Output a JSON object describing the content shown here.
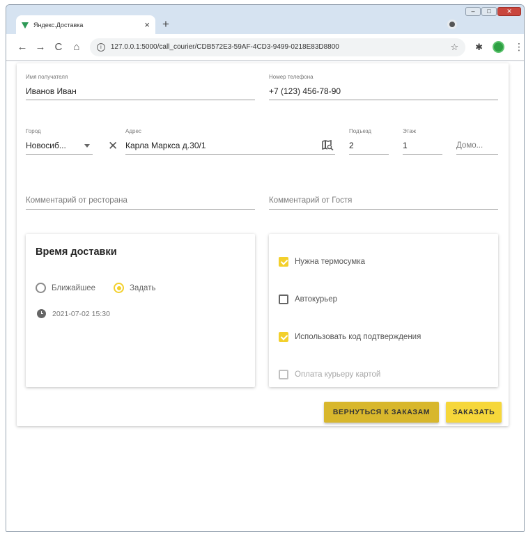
{
  "browser": {
    "tab_title": "Яндекс.Доставка",
    "tab_close": "×",
    "new_tab": "+",
    "url": "127.0.0.1:5000/call_courier/CDB572E3-59AF-4CD3-9499-0218E83D8800",
    "nav": {
      "back": "←",
      "forward": "→",
      "reload": "C",
      "home": "⌂"
    },
    "info_glyph": "i",
    "star_glyph": "☆",
    "extension_glyph": "✱",
    "menu_glyph": "⋮",
    "window_controls": {
      "minimize": "–",
      "maximize": "□",
      "close": "✕"
    }
  },
  "form": {
    "recipient": {
      "label": "Имя получателя",
      "value": "Иванов Иван"
    },
    "phone": {
      "label": "Номер телефона",
      "value": "+7 (123) 456-78-90"
    },
    "city": {
      "label": "Город",
      "value": "Новосиб..."
    },
    "address": {
      "label": "Адрес",
      "value": "Карла Маркса д.30/1",
      "clear_glyph": "✕"
    },
    "entrance": {
      "label": "Подъезд",
      "value": "2"
    },
    "floor": {
      "label": "Этаж",
      "value": "1"
    },
    "intercom": {
      "placeholder": "Домо..."
    },
    "restaurant_comment": {
      "placeholder": "Комментарий от ресторана"
    },
    "guest_comment": {
      "placeholder": "Комментарий от Гостя"
    }
  },
  "delivery": {
    "title": "Время доставки",
    "options": [
      {
        "label": "Ближайшее",
        "selected": false
      },
      {
        "label": "Задать",
        "selected": true
      }
    ],
    "datetime": "2021-07-02 15:30"
  },
  "options": [
    {
      "label": "Нужна термосумка",
      "checked": true,
      "disabled": false
    },
    {
      "label": "Автокурьер",
      "checked": false,
      "disabled": false
    },
    {
      "label": "Использовать код подтверждения",
      "checked": true,
      "disabled": false
    },
    {
      "label": "Оплата курьеру картой",
      "checked": false,
      "disabled": true
    }
  ],
  "actions": {
    "back_label": "ВЕРНУТЬСЯ К ЗАКАЗАМ",
    "order_label": "ЗАКАЗАТЬ"
  },
  "colors": {
    "accent_yellow": "#f3d02c",
    "back_button": "#d8b72c",
    "order_button": "#f6d73a"
  }
}
